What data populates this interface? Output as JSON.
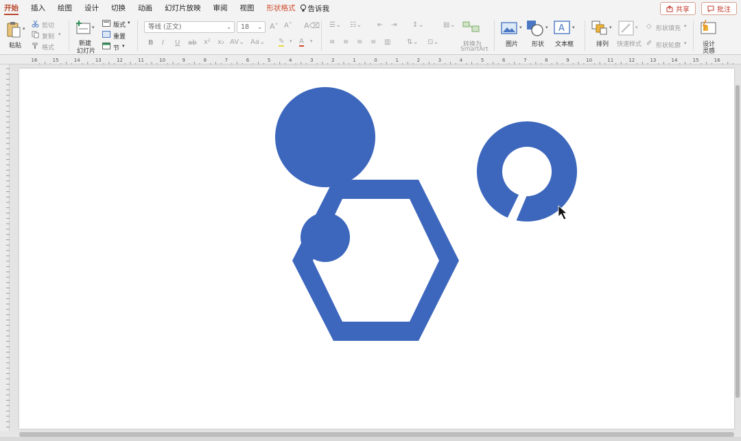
{
  "menu": {
    "tabs": [
      "开始",
      "插入",
      "绘图",
      "设计",
      "切换",
      "动画",
      "幻灯片放映",
      "审阅",
      "视图",
      "形状格式"
    ],
    "active_tab": "开始",
    "tell_me": "告诉我",
    "share": "共享",
    "comments": "批注"
  },
  "ribbon": {
    "paste": "粘贴",
    "cut": "剪切",
    "copy": "复制",
    "format_painter": "格式",
    "new_slide_1": "新建",
    "new_slide_2": "幻灯片",
    "layout": "版式",
    "reset": "重置",
    "section": "节",
    "font_name": "等线 (正文)",
    "font_size": "18",
    "convert_smartart_1": "转换为",
    "convert_smartart_2": "SmartArt",
    "picture": "图片",
    "shape": "形状",
    "textbox": "文本框",
    "arrange": "排列",
    "quick_styles": "快速样式",
    "shape_fill": "形状填充",
    "shape_outline": "形状轮廓",
    "designer_1": "设计",
    "designer_2": "灵感"
  },
  "ruler": {
    "labels": [
      "16",
      "15",
      "14",
      "13",
      "12",
      "11",
      "10",
      "9",
      "8",
      "7",
      "6",
      "5",
      "4",
      "3",
      "2",
      "1",
      "0",
      "1",
      "2",
      "3",
      "4",
      "5",
      "6",
      "7",
      "8",
      "9",
      "10",
      "11",
      "12",
      "13",
      "14",
      "15",
      "16"
    ]
  },
  "colors": {
    "shape_blue": "#3d67bd",
    "accent_red": "#b7472a"
  }
}
